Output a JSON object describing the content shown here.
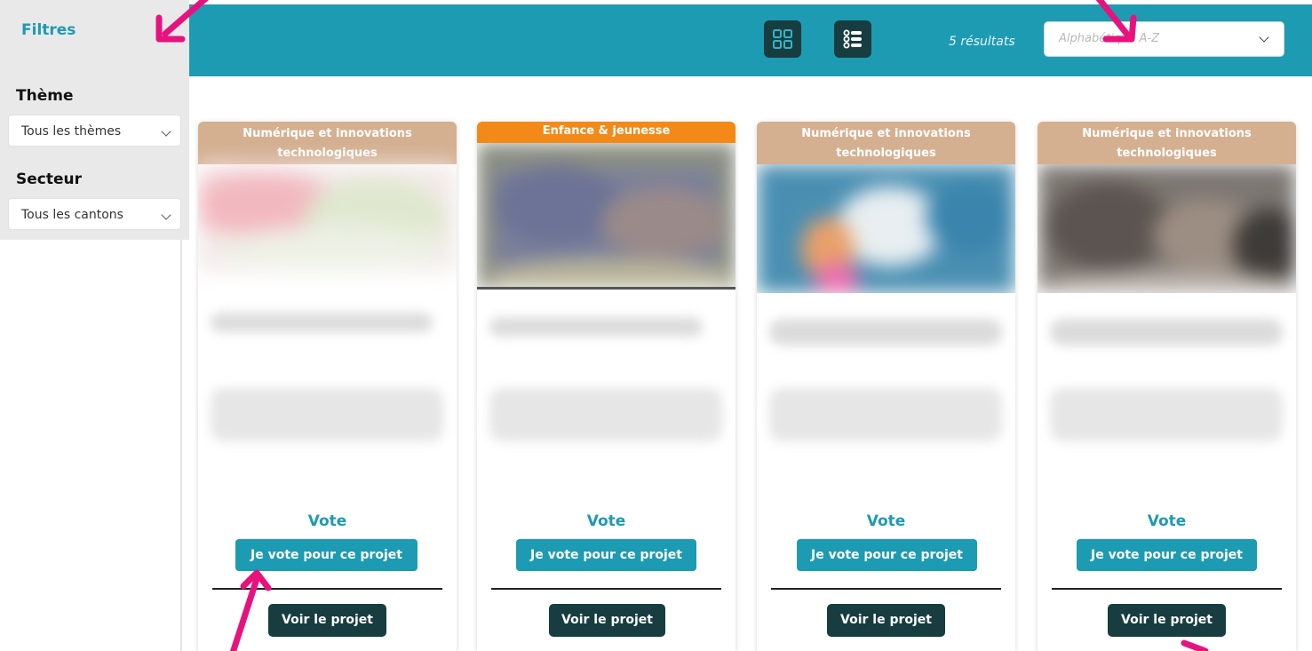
{
  "sidebar": {
    "filters_label": "Filtres",
    "theme_label": "Thème",
    "theme_select": "Tous les thèmes",
    "sector_label": "Secteur",
    "sector_select": "Tous les cantons"
  },
  "header": {
    "grid_view_icon": "grid-view-icon",
    "list_view_icon": "list-view-icon",
    "results_count": "5 résultats",
    "sort_placeholder": "Alphabétique A-Z"
  },
  "cards": [
    {
      "theme": "Numérique et innovations technologiques",
      "vote_title": "Vote",
      "vote_button": "Je vote pour ce projet",
      "see_button": "Voir le projet"
    },
    {
      "theme": "Enfance & jeunesse",
      "vote_title": "Vote",
      "vote_button": "Je vote pour ce projet",
      "see_button": "Voir le projet"
    },
    {
      "theme": "Numérique et innovations technologiques",
      "vote_title": "Vote",
      "vote_button": "Je vote pour ce projet",
      "see_button": "Voir le projet"
    },
    {
      "theme": "Numérique et innovations technologiques",
      "vote_title": "Vote",
      "vote_button": "Je vote pour ce projet",
      "see_button": "Voir le projet"
    }
  ],
  "colors": {
    "accent": "#1d9bb3",
    "dark_button": "#173d40",
    "theme_band": "#d4b091",
    "theme_band_orange": "#f38a18",
    "annotation_arrow": "#e8127f"
  }
}
